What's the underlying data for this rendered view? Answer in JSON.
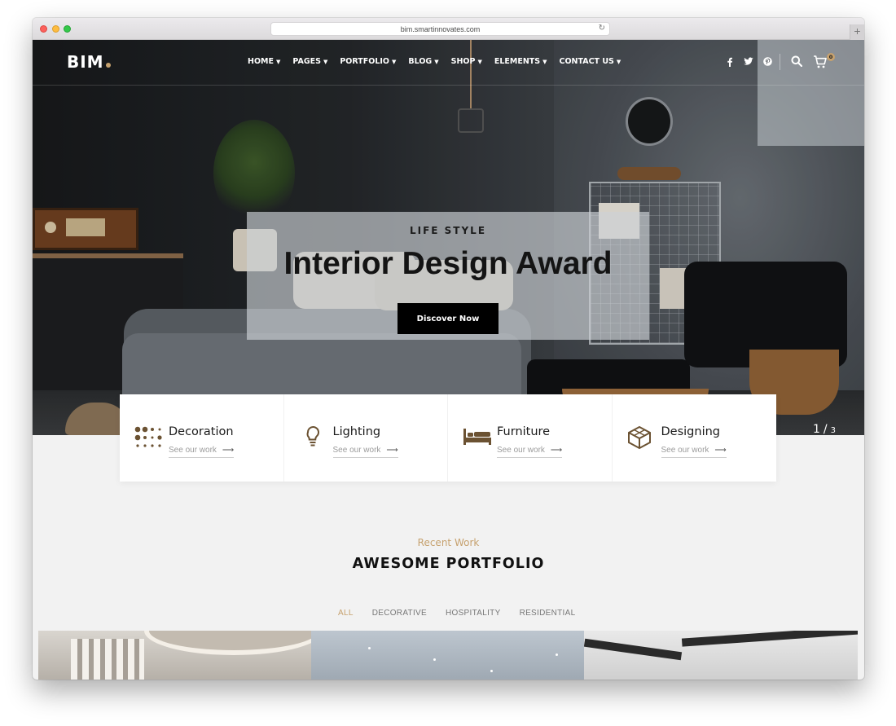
{
  "browser": {
    "url": "bim.smartinnovates.com",
    "new_tab_symbol": "+"
  },
  "header": {
    "logo": "BIM",
    "nav": [
      {
        "label": "HOME"
      },
      {
        "label": "PAGES"
      },
      {
        "label": "PORTFOLIO"
      },
      {
        "label": "BLOG"
      },
      {
        "label": "SHOP"
      },
      {
        "label": "ELEMENTS"
      },
      {
        "label": "CONTACT US"
      }
    ],
    "cart_count": "0"
  },
  "hero": {
    "kicker": "LIFE STYLE",
    "title": "Interior Design Award",
    "button": "Discover Now",
    "slide_current": "1",
    "slide_separator": "/",
    "slide_total": "3"
  },
  "services": [
    {
      "title": "Decoration",
      "link": "See our work",
      "icon": "dots-grid-icon"
    },
    {
      "title": "Lighting",
      "link": "See our work",
      "icon": "lightbulb-icon"
    },
    {
      "title": "Furniture",
      "link": "See our work",
      "icon": "bed-icon"
    },
    {
      "title": "Designing",
      "link": "See our work",
      "icon": "cube-icon"
    }
  ],
  "portfolio": {
    "kicker": "Recent Work",
    "title": "AWESOME PORTFOLIO",
    "filters": [
      {
        "label": "ALL",
        "active": true
      },
      {
        "label": "DECORATIVE",
        "active": false
      },
      {
        "label": "HOSPITALITY",
        "active": false
      },
      {
        "label": "RESIDENTIAL",
        "active": false
      }
    ]
  },
  "colors": {
    "accent": "#c6a16e",
    "dark": "#000000",
    "section_bg": "#f2f2f2",
    "icon_brown": "#6b5232"
  }
}
